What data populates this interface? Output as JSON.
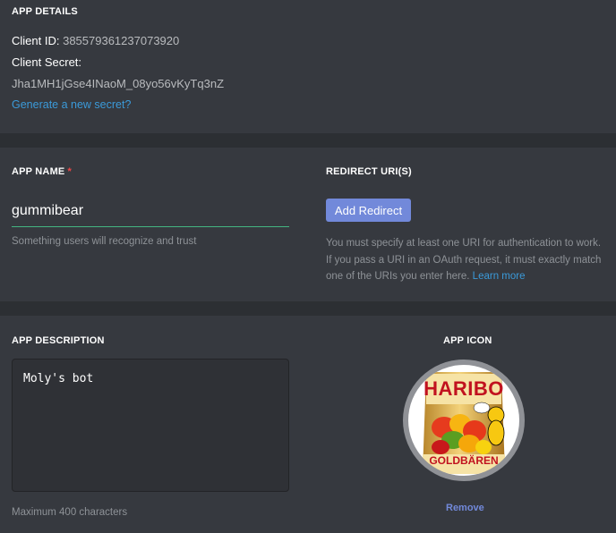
{
  "details": {
    "heading": "APP DETAILS",
    "client_id_label": "Client ID:",
    "client_id": "385579361237073920",
    "client_secret_label": "Client Secret:",
    "client_secret": "Jha1MH1jGse4INaoM_08yo56vKyTq3nZ",
    "generate_link": "Generate a new secret?"
  },
  "app_name": {
    "label": "APP NAME",
    "required_mark": "*",
    "value": "gummibear",
    "hint": "Something users will recognize and trust"
  },
  "redirect": {
    "label": "REDIRECT URI(S)",
    "button": "Add Redirect",
    "description": "You must specify at least one URI for authentication to work. If you pass a URI in an OAuth request, it must exactly match one of the URIs you enter here.",
    "learn_more": "Learn more"
  },
  "description": {
    "label": "APP DESCRIPTION",
    "value": "Moly's bot",
    "hint": "Maximum 400 characters"
  },
  "icon": {
    "label": "APP ICON",
    "image": "haribo-goldbaren-bag",
    "brand_text": "HARIBO",
    "product_text": "GOLDBÄREN",
    "remove": "Remove"
  }
}
